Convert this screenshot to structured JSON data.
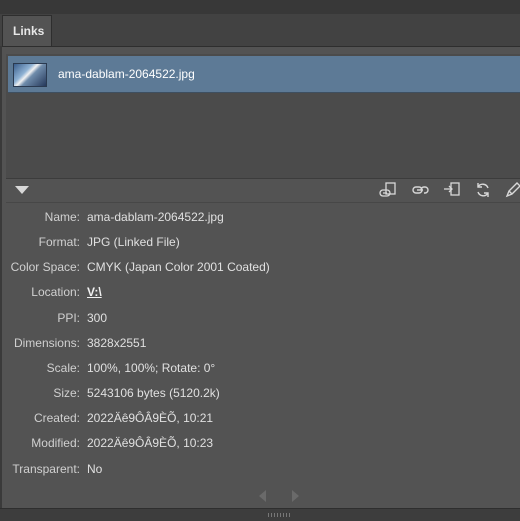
{
  "panel": {
    "tab_label": "Links"
  },
  "links": [
    {
      "name": "ama-dablam-2064522.jpg",
      "selected": true
    }
  ],
  "toolbar": {
    "icons": [
      "relink-from-cc-libraries-icon",
      "relink-icon",
      "go-to-link-icon",
      "update-link-icon",
      "edit-original-icon"
    ]
  },
  "info": {
    "name": {
      "label": "Name:",
      "value": "ama-dablam-2064522.jpg"
    },
    "format": {
      "label": "Format:",
      "value": "JPG (Linked File)"
    },
    "color_space": {
      "label": "Color Space:",
      "value": "CMYK (Japan Color 2001 Coated)"
    },
    "location": {
      "label": "Location:",
      "value": "V:\\"
    },
    "ppi": {
      "label": "PPI:",
      "value": "300"
    },
    "dimensions": {
      "label": "Dimensions:",
      "value": "3828x2551"
    },
    "scale": {
      "label": "Scale:",
      "value": "100%, 100%; Rotate: 0°"
    },
    "size": {
      "label": "Size:",
      "value": "5243106 bytes (5120.2k)"
    },
    "created": {
      "label": "Created:",
      "value": "2022Äê9ÔÂ9ÈÕ, 10:21"
    },
    "modified": {
      "label": "Modified:",
      "value": "2022Äê9ÔÂ9ÈÕ, 10:23"
    },
    "transparent": {
      "label": "Transparent:",
      "value": "No"
    }
  },
  "colors": {
    "panel_bg": "#535353",
    "selection": "#5d7a96",
    "tab_bar": "#424242"
  }
}
